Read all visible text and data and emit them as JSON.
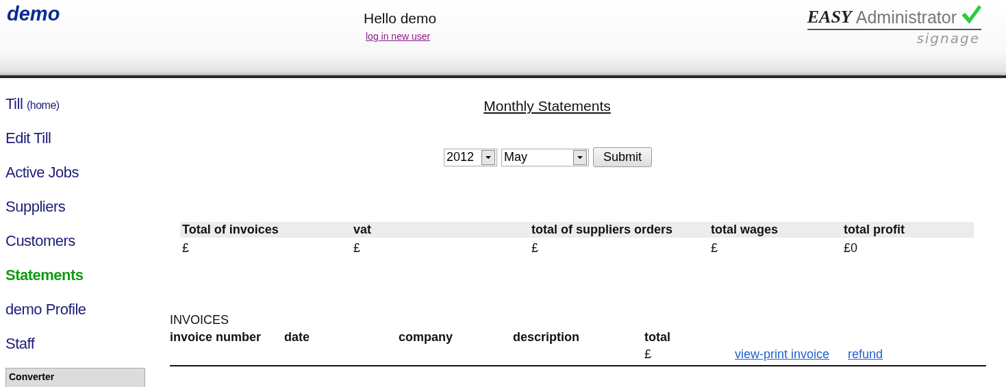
{
  "header": {
    "site_name": "demo",
    "greeting": "Hello demo",
    "login_link": "log in new user",
    "logo": {
      "brand": "EASY",
      "product": "Administrator",
      "tagline": "signage"
    }
  },
  "sidebar": {
    "items": [
      {
        "label": "Till",
        "note": "(home)",
        "selected": false
      },
      {
        "label": "Edit Till",
        "selected": false
      },
      {
        "label": "Active Jobs",
        "selected": false
      },
      {
        "label": "Suppliers",
        "selected": false
      },
      {
        "label": "Customers",
        "selected": false
      },
      {
        "label": "Statements",
        "selected": true
      },
      {
        "label": "demo Profile",
        "selected": false
      },
      {
        "label": "Staff",
        "selected": false
      }
    ],
    "panel_title": "Converter"
  },
  "page_title": "Monthly Statements",
  "filters": {
    "year": "2012",
    "month": "May",
    "submit": "Submit"
  },
  "summary": {
    "columns": [
      "Total of invoices",
      "vat",
      "total of suppliers orders",
      "total wages",
      "total profit"
    ],
    "values": [
      "£",
      "£",
      "£",
      "£",
      "£0"
    ]
  },
  "invoices": {
    "title": "INVOICES",
    "columns": [
      "invoice number",
      "date",
      "company",
      "description",
      "total"
    ],
    "rows": [
      {
        "total": "£",
        "actions": [
          "view-print invoice",
          "refund"
        ]
      }
    ]
  }
}
